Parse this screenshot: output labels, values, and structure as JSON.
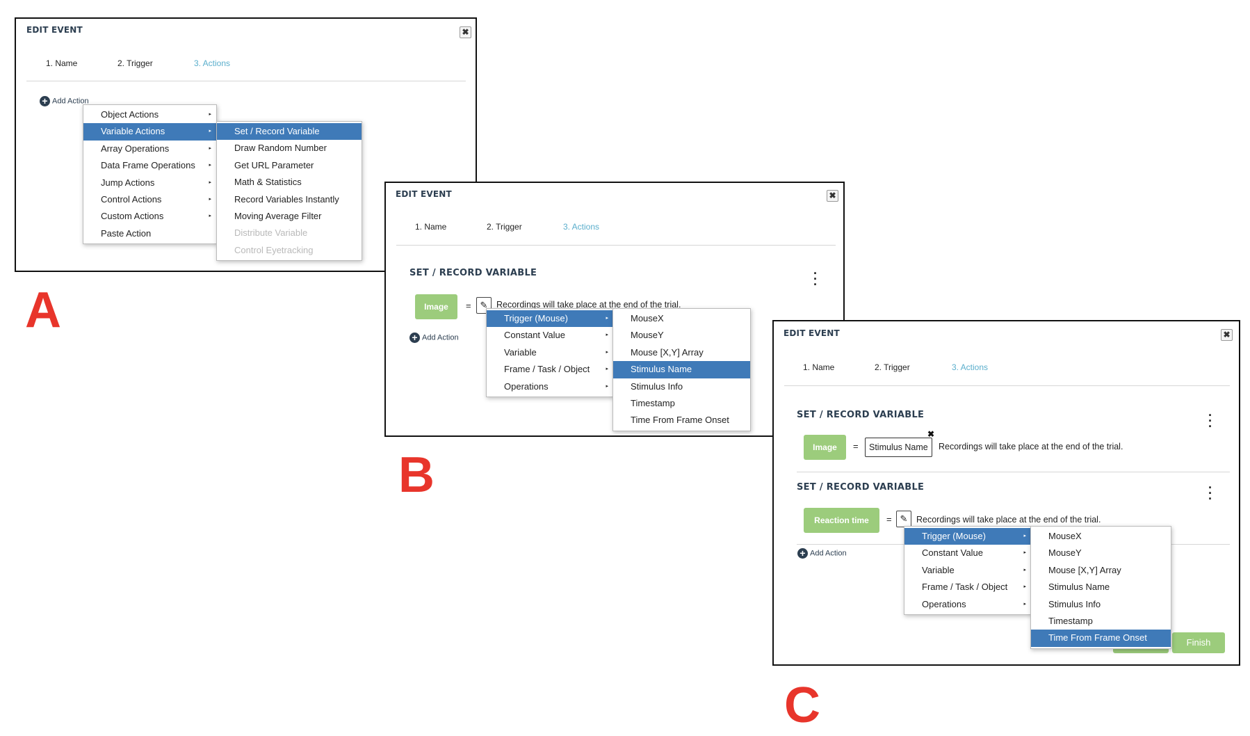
{
  "panels": {
    "a": {
      "title": "EDIT EVENT",
      "close": "✖",
      "tabs": [
        "1. Name",
        "2. Trigger",
        "3. Actions"
      ],
      "add_action": "Add Action",
      "menu": [
        {
          "label": "Object Actions",
          "arrow": "▸"
        },
        {
          "label": "Variable Actions",
          "arrow": "▸"
        },
        {
          "label": "Array Operations",
          "arrow": "▸"
        },
        {
          "label": "Data Frame Operations",
          "arrow": "▸"
        },
        {
          "label": "Jump Actions",
          "arrow": "▸"
        },
        {
          "label": "Control Actions",
          "arrow": "▸"
        },
        {
          "label": "Custom Actions",
          "arrow": "▸"
        },
        {
          "label": "Paste Action",
          "arrow": ""
        }
      ],
      "submenu": [
        "Set / Record Variable",
        "Draw Random Number",
        "Get URL Parameter",
        "Math & Statistics",
        "Record Variables Instantly",
        "Moving Average Filter",
        "Distribute Variable",
        "Control Eyetracking"
      ]
    },
    "b": {
      "title": "EDIT EVENT",
      "close": "✖",
      "tabs": [
        "1. Name",
        "2. Trigger",
        "3. Actions"
      ],
      "section_title": "SET / RECORD VARIABLE",
      "variable": "Image",
      "equals": "=",
      "recordings": "Recordings will take place at the end of the trial.",
      "add_action": "Add Action",
      "menu": [
        {
          "label": "Trigger (Mouse)",
          "arrow": "▸"
        },
        {
          "label": "Constant Value",
          "arrow": "▸"
        },
        {
          "label": "Variable",
          "arrow": "▸"
        },
        {
          "label": "Frame / Task / Object",
          "arrow": "▸"
        },
        {
          "label": "Operations",
          "arrow": "▸"
        }
      ],
      "submenu": [
        "MouseX",
        "MouseY",
        "Mouse [X,Y] Array",
        "Stimulus Name",
        "Stimulus Info",
        "Timestamp",
        "Time From Frame Onset"
      ]
    },
    "c": {
      "title": "EDIT EVENT",
      "close": "✖",
      "tabs": [
        "1. Name",
        "2. Trigger",
        "3. Actions"
      ],
      "section1_title": "SET / RECORD VARIABLE",
      "variable1": "Image",
      "equals": "=",
      "value1": "Stimulus Name",
      "remove": "✖",
      "recordings": "Recordings will take place at the end of the trial.",
      "section2_title": "SET / RECORD VARIABLE",
      "variable2": "Reaction time",
      "add_action": "Add Action",
      "finish": "Finish",
      "menu": [
        {
          "label": "Trigger (Mouse)",
          "arrow": "▸"
        },
        {
          "label": "Constant Value",
          "arrow": "▸"
        },
        {
          "label": "Variable",
          "arrow": "▸"
        },
        {
          "label": "Frame / Task / Object",
          "arrow": "▸"
        },
        {
          "label": "Operations",
          "arrow": "▸"
        }
      ],
      "submenu": [
        "MouseX",
        "MouseY",
        "Mouse [X,Y] Array",
        "Stimulus Name",
        "Stimulus Info",
        "Timestamp",
        "Time From Frame Onset"
      ]
    }
  },
  "labels": {
    "a": "A",
    "b": "B",
    "c": "C"
  },
  "colors": {
    "accent_blue": "#3f7ab8",
    "variable_green": "#9ccc7c",
    "tab_active": "#5aaecc",
    "label_red": "#e8352b"
  }
}
